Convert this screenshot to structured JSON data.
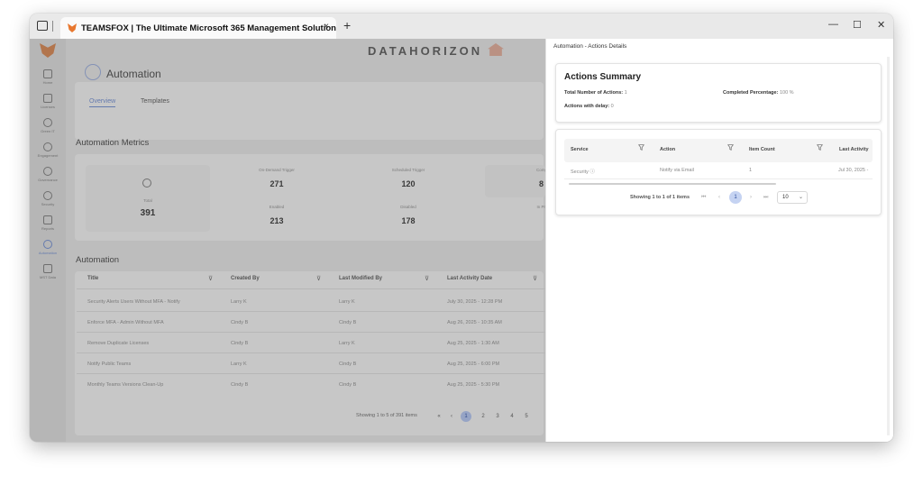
{
  "browser": {
    "tab_title": "TEAMSFOX | The Ultimate Microsoft 365 Management Solution",
    "tab_close": "×",
    "new_tab": "+",
    "minimize": "—",
    "maximize": "☐",
    "close": "✕"
  },
  "brand": "DATAHORIZON",
  "sidebar": {
    "items": [
      {
        "label": "Home",
        "icon": "home-icon"
      },
      {
        "label": "Licenses",
        "icon": "licenses-icon"
      },
      {
        "label": "Green IT",
        "icon": "leaf-icon"
      },
      {
        "label": "Engagement",
        "icon": "engagement-icon"
      },
      {
        "label": "Governance",
        "icon": "governance-icon"
      },
      {
        "label": "Security",
        "icon": "security-icon"
      },
      {
        "label": "Reports",
        "icon": "reports-icon"
      },
      {
        "label": "Automation",
        "icon": "automation-icon",
        "active": true
      },
      {
        "label": "MST Data",
        "icon": "data-icon"
      }
    ]
  },
  "page": {
    "title": "Automation",
    "tabs": [
      {
        "label": "Overview",
        "active": true
      },
      {
        "label": "Templates"
      }
    ]
  },
  "metrics": {
    "section_title": "Automation Metrics",
    "total_label": "Total",
    "total_value": "391",
    "on_demand_label": "On-Demand Trigger",
    "on_demand_value": "271",
    "scheduled_label": "Scheduled Trigger",
    "scheduled_value": "120",
    "enabled_label": "Enabled",
    "enabled_value": "213",
    "disabled_label": "Disabled",
    "disabled_value": "178",
    "comp_label": "Compl",
    "comp_value": "8",
    "inp_label": "In Pr"
  },
  "automation_table": {
    "section_title": "Automation",
    "columns": [
      "Title",
      "Created By",
      "Last Modified By",
      "Last Activity Date"
    ],
    "rows": [
      [
        "Security Alerts Users Without MFA - Notify",
        "Larry K",
        "Larry K",
        "July 30, 2025 - 12:28 PM"
      ],
      [
        "Enforce MFA - Admin Without MFA",
        "Cindy B",
        "Cindy B",
        "Aug 26, 2025 - 10:35 AM"
      ],
      [
        "Remove Duplicate Licenses",
        "Cindy B",
        "Larry K",
        "Aug 25, 2025 - 1:30 AM"
      ],
      [
        "Notify Public Teams",
        "Larry K",
        "Cindy B",
        "Aug 25, 2025 - 6:00 PM"
      ],
      [
        "Monthly Teams Versions Clean-Up",
        "Cindy B",
        "Cindy B",
        "Aug 25, 2025 - 5:30 PM"
      ]
    ],
    "pager_text": "Showing 1 to 5 of 391 items",
    "pages": [
      "1",
      "2",
      "3",
      "4",
      "5"
    ]
  },
  "drawer": {
    "title": "Automation - Actions Details",
    "summary": {
      "heading": "Actions Summary",
      "total_label": "Total Number of Actions:",
      "total_value": "1",
      "completed_label": "Completed Percentage:",
      "completed_value": "100 %",
      "delay_label": "Actions with delay:",
      "delay_value": "0"
    },
    "actions_table": {
      "columns": [
        "Service",
        "Action",
        "Item Count",
        "Last Activity"
      ],
      "row": {
        "service": "Security",
        "action": "Notify via Email",
        "item_count": "1",
        "last_activity": "Jul 30, 2025 -"
      },
      "showing": "Showing 1 to 1 of 1 items",
      "nav_first": "⏮",
      "nav_prev": "‹",
      "page": "1",
      "nav_next": "›",
      "nav_last": "⏭",
      "page_size": "10"
    }
  },
  "colors": {
    "accent": "#6a86c8",
    "page_active": "#c5d3f2"
  }
}
